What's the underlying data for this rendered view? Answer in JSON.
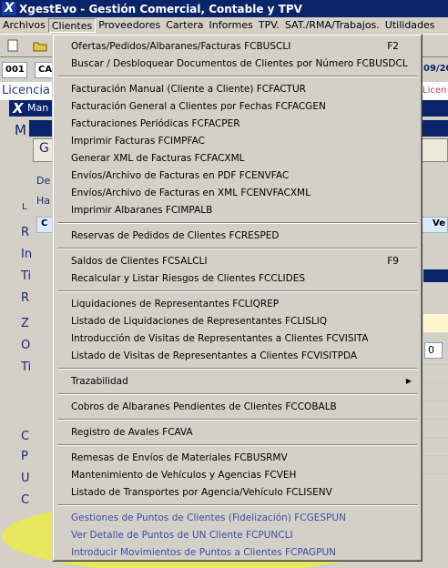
{
  "window": {
    "title": "XgestEvo - Gestión Comercial, Contable y TPV"
  },
  "menubar": [
    "Archivos",
    "Clientes",
    "Proveedores",
    "Cartera",
    "Informes",
    "TPV.",
    "SAT./RMA/Trabajos.",
    "Utilidades"
  ],
  "background": {
    "code": "001",
    "code_prefix": "CA",
    "date": "09/20",
    "licence_left": "Licencia",
    "licence_right": "Licen",
    "window_title": "Man",
    "window_letter": "M",
    "subwindow_letter": "G",
    "row_labels": [
      "De",
      "Ha"
    ],
    "tab_letter": "L",
    "col_c": "C",
    "col_ve": "Ve",
    "field_zero": "0",
    "side_letters": [
      "R",
      "In",
      "Ti",
      "R",
      "Z",
      "O",
      "Ti",
      "C",
      "P",
      "U",
      "C"
    ]
  },
  "menu": {
    "groups": [
      [
        {
          "label": "Ofertas/Pedidos/Albaranes/Facturas FCBUSCLI",
          "shortcut": "F2"
        },
        {
          "label": "Buscar / Desbloquear Documentos de Clientes por Número FCBUSDCL"
        }
      ],
      [
        {
          "label": "Facturación Manual (Cliente a Cliente) FCFACTUR"
        },
        {
          "label": "Facturación General a Clientes por Fechas FCFACGEN"
        },
        {
          "label": "Facturaciones Periódicas FCFACPER"
        },
        {
          "label": "Imprimir Facturas FCIMPFAC"
        },
        {
          "label": "Generar XML de Facturas FCFACXML"
        },
        {
          "label": "Envíos/Archivo de Facturas en PDF FCENVFAC"
        },
        {
          "label": "Envíos/Archivo de Facturas en XML FCENVFACXML"
        },
        {
          "label": "Imprimir Albaranes FCIMPALB"
        }
      ],
      [
        {
          "label": "Reservas de Pedidos de Clientes FCRESPED"
        }
      ],
      [
        {
          "label": "Saldos de Clientes FCSALCLI",
          "shortcut": "F9"
        },
        {
          "label": "Recalcular y Listar Riesgos de Clientes FCCLIDES"
        }
      ],
      [
        {
          "label": "Liquidaciones de Representantes FCLIQREP"
        },
        {
          "label": "Listado de Liquidaciones de Representantes FCLISLIQ"
        },
        {
          "label": "Introducción de Visitas de Representantes a Clientes FCVISITA"
        },
        {
          "label": "Listado de Visitas de Representantes a Clientes FCVISITPDA"
        }
      ],
      [
        {
          "label": "Trazabilidad",
          "submenu": true
        }
      ],
      [
        {
          "label": "Cobros de Albaranes Pendientes de Clientes FCCOBALB"
        }
      ],
      [
        {
          "label": "Registro de Avales FCAVA"
        }
      ],
      [
        {
          "label": "Remesas de Envíos de Materiales FCBUSRMV"
        },
        {
          "label": "Mantenimiento de Vehículos y Agencias FCVEH"
        },
        {
          "label": "Listado de Transportes por Agencia/Vehículo FCLISENV"
        }
      ],
      [
        {
          "label": "Gestiones de Puntos de Clientes (Fidelización) FCGESPUN",
          "highlighted": true
        },
        {
          "label": "Ver Detalle de Puntos de UN Cliente FCPUNCLI",
          "highlighted": true
        },
        {
          "label": "Introducir Movimientos de Puntos a Clientes FCPAGPUN",
          "highlighted": true
        }
      ]
    ]
  },
  "colors": {
    "titlebar": "#0a246a",
    "menu_bg": "#d4d0c8",
    "highlight_marker": "#eeee3c",
    "highlight_text": "#3b4fa8"
  }
}
